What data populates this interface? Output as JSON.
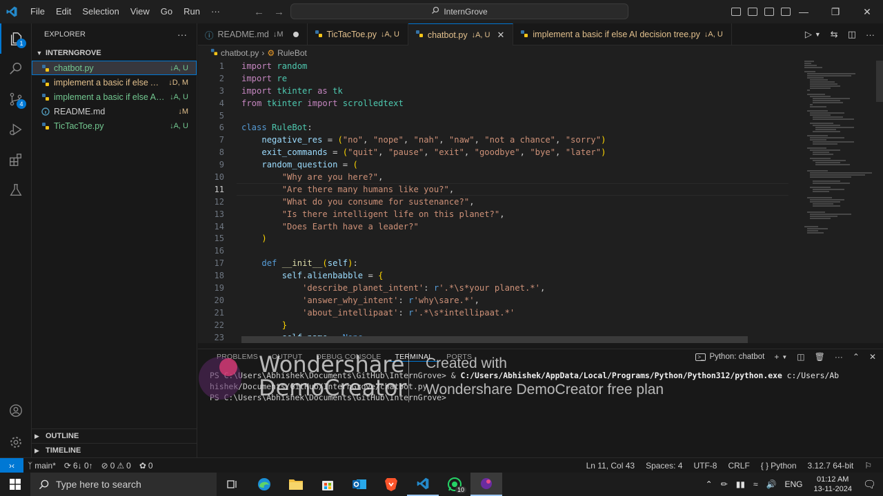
{
  "titlebar": {
    "menu": [
      "File",
      "Edit",
      "Selection",
      "View",
      "Go",
      "Run",
      "···"
    ],
    "search": "InternGrove"
  },
  "sidebar": {
    "title": "EXPLORER",
    "more": "···",
    "folder": "INTERNGROVE",
    "files": [
      {
        "name": "chatbot.py",
        "status": "↓A, U"
      },
      {
        "name": "implement a basic if else AI ...",
        "status": "↓D, M"
      },
      {
        "name": "implement a basic if else AI ...",
        "status": "↓A, U"
      },
      {
        "name": "README.md",
        "status": "↓M"
      },
      {
        "name": "TicTacToe.py",
        "status": "↓A, U"
      }
    ],
    "outline": "OUTLINE",
    "timeline": "TIMELINE"
  },
  "activity": {
    "explorer_badge": "1",
    "scm_badge": "4"
  },
  "tabs": [
    {
      "name": "README.md",
      "status": "↓M"
    },
    {
      "name": "TicTacToe.py",
      "status": "↓A, U"
    },
    {
      "name": "chatbot.py",
      "status": "↓A, U"
    },
    {
      "name": "implement a basic if else AI decision tree.py",
      "status": "↓A, U"
    }
  ],
  "breadcrumb": {
    "file": "chatbot.py",
    "sep": "›",
    "symbol": "RuleBot"
  },
  "editor": {
    "line_numbers": [
      "1",
      "2",
      "3",
      "4",
      "5",
      "6",
      "7",
      "8",
      "9",
      "10",
      "11",
      "12",
      "13",
      "14",
      "15",
      "16",
      "17",
      "18",
      "19",
      "20",
      "21",
      "22",
      "23"
    ],
    "current_line": 11
  },
  "panel": {
    "tabs": [
      "PROBLEMS",
      "OUTPUT",
      "DEBUG CONSOLE",
      "TERMINAL",
      "PORTS"
    ],
    "terminal_name": "Python: chatbot",
    "lines": [
      {
        "prompt": "PS C:\\Users\\Abhishek\\Documents\\GitHub\\InternGrove> & ",
        "cmd": "C:/Users/Abhishek/AppData/Local/Programs/Python/Python312/python.exe",
        "rest": " c:/Users/Ab"
      },
      {
        "prompt": "hishek/Documents/GitHub/InternGrove/chatbot.py",
        "cmd": "",
        "rest": ""
      },
      {
        "prompt": "PS C:\\Users\\Abhishek\\Documents\\GitHub\\InternGrove>",
        "cmd": "",
        "rest": ""
      }
    ]
  },
  "watermark": {
    "brand1": "Wondershare",
    "brand2": "DemoCreator",
    "text1": "Created with",
    "text2": "Wondershare DemoCreator free plan"
  },
  "statusbar": {
    "branch": "main*",
    "sync": "6↓ 0↑",
    "errors": "0",
    "warnings": "0",
    "ports": "0",
    "position": "Ln 11, Col 43",
    "spaces": "Spaces: 4",
    "encoding": "UTF-8",
    "eol": "CRLF",
    "language": "Python",
    "interpreter": "3.12.7 64-bit"
  },
  "taskbar": {
    "search_placeholder": "Type here to search",
    "whatsapp_badge": "10",
    "lang": "ENG",
    "time": "01:12 AM",
    "date": "13-11-2024"
  },
  "colors": {
    "accent": "#0078d4",
    "git_added": "#73c991",
    "git_modified": "#e2c08d"
  }
}
